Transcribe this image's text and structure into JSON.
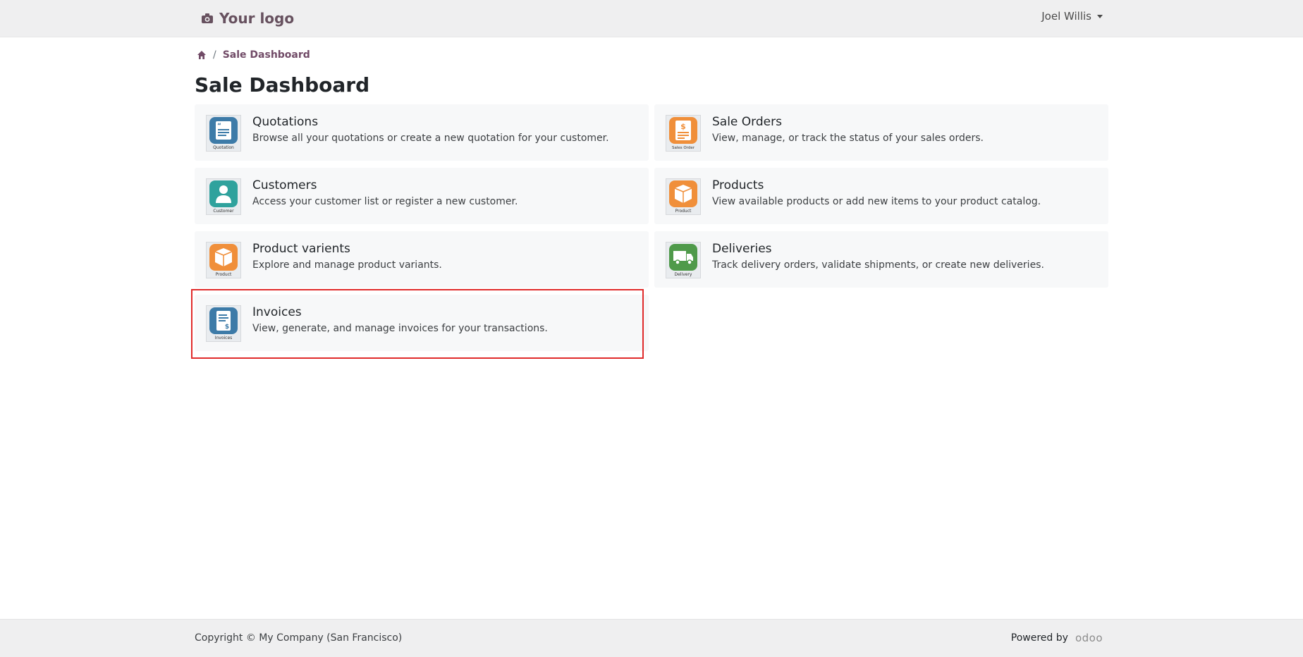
{
  "header": {
    "logo_text": "Your logo",
    "logo_icon": "camera-icon",
    "user_name": "Joel Willis"
  },
  "breadcrumb": {
    "home_icon": "home-icon",
    "separator": "/",
    "current": "Sale Dashboard"
  },
  "page": {
    "title": "Sale Dashboard"
  },
  "cards": [
    {
      "title": "Quotations",
      "description": "Browse all your quotations or create a new quotation for your customer.",
      "icon": "quotation-icon",
      "icon_caption": "Quotation",
      "icon_color": "#3d7ba8"
    },
    {
      "title": "Sale Orders",
      "description": "View, manage, or track the status of your sales orders.",
      "icon": "sales-order-icon",
      "icon_caption": "Sales Order",
      "icon_color": "#f08f3a"
    },
    {
      "title": "Customers",
      "description": "Access your customer list or register a new customer.",
      "icon": "customer-icon",
      "icon_caption": "Customer",
      "icon_color": "#2fa29d"
    },
    {
      "title": "Products",
      "description": "View available products or add new items to your product catalog.",
      "icon": "product-icon",
      "icon_caption": "Product",
      "icon_color": "#f08f3a"
    },
    {
      "title": "Product varients",
      "description": "Explore and manage product variants.",
      "icon": "product-variant-icon",
      "icon_caption": "Product",
      "icon_color": "#f08f3a"
    },
    {
      "title": "Deliveries",
      "description": "Track delivery orders, validate shipments, or create new deliveries.",
      "icon": "delivery-icon",
      "icon_caption": "Delivery",
      "icon_color": "#4f9a4a"
    },
    {
      "title": "Invoices",
      "description": "View, generate, and manage invoices for your transactions.",
      "icon": "invoice-icon",
      "icon_caption": "Invoices",
      "icon_color": "#3d7ba8"
    }
  ],
  "footer": {
    "copyright": "Copyright © My Company (San Francisco)",
    "powered_by": "Powered by",
    "brand": "odoo"
  },
  "colors": {
    "brand": "#714b67",
    "highlight": "#e02b2b"
  }
}
